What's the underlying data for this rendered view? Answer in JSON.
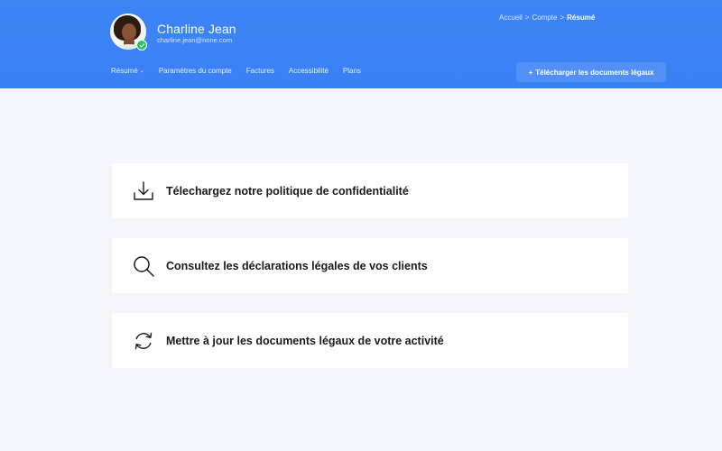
{
  "user": {
    "name": "Charline Jean",
    "email": "charline.jean@none.com"
  },
  "breadcrumb": {
    "items": [
      "Accueil",
      "Compte"
    ],
    "current": "Résumé",
    "separator": ">"
  },
  "nav": {
    "items": [
      {
        "label": "Résumé",
        "has_dropdown": true
      },
      {
        "label": "Paramètres du compte"
      },
      {
        "label": "Factures"
      },
      {
        "label": "Accessibilité"
      },
      {
        "label": "Plans"
      }
    ],
    "dropdown_glyph": "⌄"
  },
  "cta": {
    "plus": "+",
    "label": "Télécharger les documents légaux"
  },
  "cards": [
    {
      "label": "Télechargez notre politique de confidentialité",
      "icon": "download-icon"
    },
    {
      "label": "Consultez les déclarations légales de vos clients",
      "icon": "search-icon"
    },
    {
      "label": "Mettre à jour les documents légaux de votre activité",
      "icon": "refresh-icon"
    }
  ],
  "colors": {
    "header": "#3b82f6",
    "background": "#f4f6fb",
    "verified": "#22c55e"
  }
}
